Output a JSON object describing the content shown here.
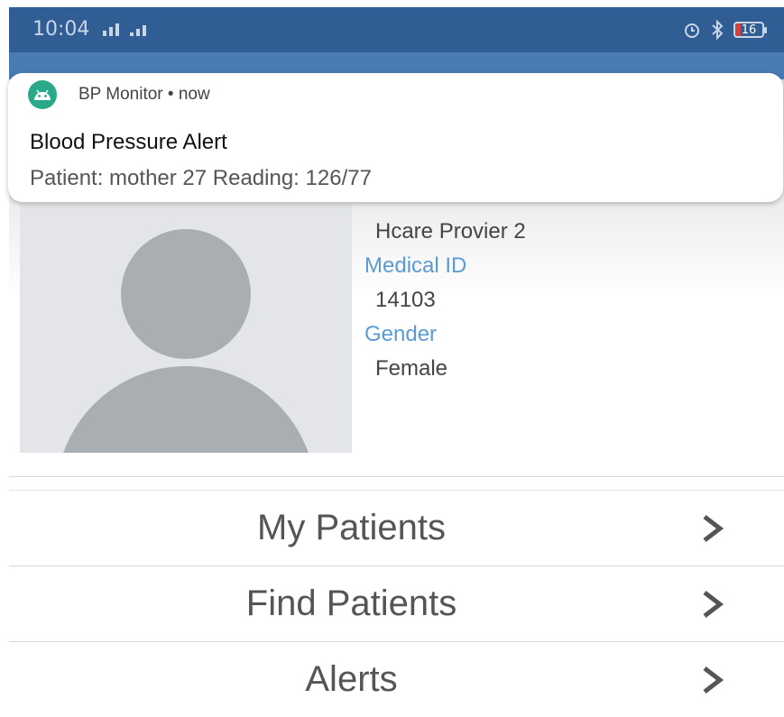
{
  "status_bar": {
    "time": "10:04",
    "battery": "16",
    "icons": [
      "signal-icon",
      "alarm-icon",
      "bluetooth-icon",
      "battery-icon"
    ]
  },
  "notification": {
    "app_name": "BP Monitor",
    "separator": "•",
    "time": "now",
    "title": "Blood Pressure Alert",
    "body": "Patient: mother 27  Reading: 126/77",
    "icon": "android-icon"
  },
  "profile": {
    "name": "Hcare Provier 2",
    "medical_id_label": "Medical ID",
    "medical_id": "14103",
    "gender_label": "Gender",
    "gender": "Female"
  },
  "menu": {
    "items": [
      {
        "label": "My Patients"
      },
      {
        "label": "Find Patients"
      },
      {
        "label": "Alerts"
      }
    ]
  },
  "colors": {
    "status_bar": "#2f5d94",
    "app_bar": "#4a7bb3",
    "label_blue": "#5b9bd5",
    "avatar_gray": "#a9aeb3"
  }
}
